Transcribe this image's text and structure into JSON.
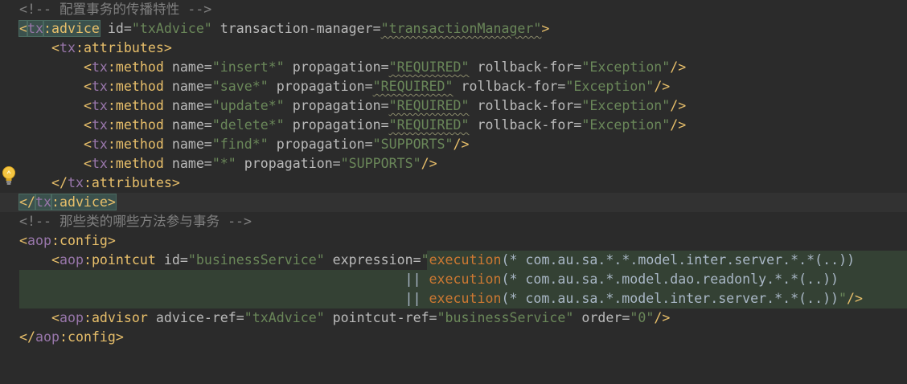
{
  "editor": {
    "language": "xml",
    "lines": [
      {
        "tokens": [
          {
            "t": "<!-- 配置事务的传播特性 -->",
            "c": "cmt"
          }
        ]
      },
      {
        "tokens": [
          {
            "t": "<",
            "c": "tag match"
          },
          {
            "t": "tx",
            "c": "ns match"
          },
          {
            "t": ":advice",
            "c": "tag match"
          },
          {
            "t": " id=",
            "c": "attr"
          },
          {
            "t": "\"txAdvice\"",
            "c": "val"
          },
          {
            "t": " transaction-manager=",
            "c": "attr"
          },
          {
            "t": "\"transactionManager\"",
            "c": "val sq"
          },
          {
            "t": ">",
            "c": "tag"
          }
        ]
      },
      {
        "indent": "    ",
        "tokens": [
          {
            "t": "<",
            "c": "tag"
          },
          {
            "t": "tx",
            "c": "ns"
          },
          {
            "t": ":attributes>",
            "c": "tag"
          }
        ]
      },
      {
        "indent": "        ",
        "tokens": [
          {
            "t": "<",
            "c": "tag"
          },
          {
            "t": "tx",
            "c": "ns"
          },
          {
            "t": ":method",
            "c": "tag"
          },
          {
            "t": " name=",
            "c": "attr"
          },
          {
            "t": "\"insert*\"",
            "c": "val"
          },
          {
            "t": " propagation=",
            "c": "attr"
          },
          {
            "t": "\"REQUIRED\"",
            "c": "val sq"
          },
          {
            "t": " rollback-for=",
            "c": "attr"
          },
          {
            "t": "\"Exception\"",
            "c": "val"
          },
          {
            "t": "/>",
            "c": "tag"
          }
        ]
      },
      {
        "indent": "        ",
        "tokens": [
          {
            "t": "<",
            "c": "tag"
          },
          {
            "t": "tx",
            "c": "ns"
          },
          {
            "t": ":method",
            "c": "tag"
          },
          {
            "t": " name=",
            "c": "attr"
          },
          {
            "t": "\"save*\"",
            "c": "val"
          },
          {
            "t": " propagation=",
            "c": "attr"
          },
          {
            "t": "\"REQUIRED\"",
            "c": "val sq"
          },
          {
            "t": " rollback-for=",
            "c": "attr"
          },
          {
            "t": "\"Exception\"",
            "c": "val"
          },
          {
            "t": "/>",
            "c": "tag"
          }
        ]
      },
      {
        "indent": "        ",
        "tokens": [
          {
            "t": "<",
            "c": "tag"
          },
          {
            "t": "tx",
            "c": "ns"
          },
          {
            "t": ":method",
            "c": "tag"
          },
          {
            "t": " name=",
            "c": "attr"
          },
          {
            "t": "\"update*\"",
            "c": "val"
          },
          {
            "t": " propagation=",
            "c": "attr"
          },
          {
            "t": "\"REQUIRED\"",
            "c": "val sq"
          },
          {
            "t": " rollback-for=",
            "c": "attr"
          },
          {
            "t": "\"Exception\"",
            "c": "val"
          },
          {
            "t": "/>",
            "c": "tag"
          }
        ]
      },
      {
        "indent": "        ",
        "tokens": [
          {
            "t": "<",
            "c": "tag"
          },
          {
            "t": "tx",
            "c": "ns"
          },
          {
            "t": ":method",
            "c": "tag"
          },
          {
            "t": " name=",
            "c": "attr"
          },
          {
            "t": "\"delete*\"",
            "c": "val"
          },
          {
            "t": " propagation=",
            "c": "attr"
          },
          {
            "t": "\"REQUIRED\"",
            "c": "val sq"
          },
          {
            "t": " rollback-for=",
            "c": "attr"
          },
          {
            "t": "\"Exception\"",
            "c": "val"
          },
          {
            "t": "/>",
            "c": "tag"
          }
        ]
      },
      {
        "indent": "        ",
        "tokens": [
          {
            "t": "<",
            "c": "tag"
          },
          {
            "t": "tx",
            "c": "ns"
          },
          {
            "t": ":method",
            "c": "tag"
          },
          {
            "t": " name=",
            "c": "attr"
          },
          {
            "t": "\"find*\"",
            "c": "val"
          },
          {
            "t": " propagation=",
            "c": "attr"
          },
          {
            "t": "\"SUPPORTS\"",
            "c": "val"
          },
          {
            "t": "/>",
            "c": "tag"
          }
        ]
      },
      {
        "indent": "        ",
        "tokens": [
          {
            "t": "<",
            "c": "tag"
          },
          {
            "t": "tx",
            "c": "ns"
          },
          {
            "t": ":method",
            "c": "tag"
          },
          {
            "t": " name=",
            "c": "attr"
          },
          {
            "t": "\"*\"",
            "c": "val"
          },
          {
            "t": " propagation=",
            "c": "attr"
          },
          {
            "t": "\"SUPPORTS\"",
            "c": "val"
          },
          {
            "t": "/>",
            "c": "tag"
          }
        ]
      },
      {
        "indent": "    ",
        "tokens": [
          {
            "t": "</",
            "c": "tag"
          },
          {
            "t": "tx",
            "c": "ns"
          },
          {
            "t": ":attributes>",
            "c": "tag"
          }
        ]
      },
      {
        "current": true,
        "tokens": [
          {
            "t": "</",
            "c": "tag match"
          },
          {
            "t": "tx",
            "c": "ns match"
          },
          {
            "t": ":advice>",
            "c": "tag match"
          }
        ]
      },
      {
        "tokens": [
          {
            "t": "<!-- 那些类的哪些方法参与事务 -->",
            "c": "cmt"
          }
        ]
      },
      {
        "tokens": [
          {
            "t": "<",
            "c": "tag"
          },
          {
            "t": "aop",
            "c": "ns"
          },
          {
            "t": ":config>",
            "c": "tag"
          }
        ]
      },
      {
        "indent": "    ",
        "tokens": [
          {
            "t": "<",
            "c": "tag"
          },
          {
            "t": "aop",
            "c": "ns"
          },
          {
            "t": ":pointcut",
            "c": "tag"
          },
          {
            "t": " id=",
            "c": "attr"
          },
          {
            "t": "\"businessService\"",
            "c": "val"
          },
          {
            "t": " expression=",
            "c": "attr"
          },
          {
            "t": "\"",
            "c": "val"
          },
          {
            "t": "execution",
            "c": "kw"
          },
          {
            "t": "(* com.au.sa.*.*.model.inter.server.*.*(..))",
            "c": "plain"
          }
        ]
      },
      {
        "indent": "                                                ",
        "tokens": [
          {
            "t": "||",
            "c": "plain"
          },
          {
            "t": " ",
            "c": "plain"
          },
          {
            "t": "execution",
            "c": "kw"
          },
          {
            "t": "(* com.au.sa.*.model.dao.readonly.*.*(..))",
            "c": "plain"
          }
        ]
      },
      {
        "indent": "                                                ",
        "tokens": [
          {
            "t": "||",
            "c": "plain"
          },
          {
            "t": " ",
            "c": "plain"
          },
          {
            "t": "execution",
            "c": "kw"
          },
          {
            "t": "(* com.au.sa.*.model.inter.server.*.*(..))",
            "c": "plain"
          },
          {
            "t": "\"",
            "c": "val"
          },
          {
            "t": "/>",
            "c": "tag"
          }
        ]
      },
      {
        "indent": "    ",
        "tokens": [
          {
            "t": "<",
            "c": "tag"
          },
          {
            "t": "aop",
            "c": "ns"
          },
          {
            "t": ":advisor",
            "c": "tag"
          },
          {
            "t": " advice-ref=",
            "c": "attr"
          },
          {
            "t": "\"txAdvice\"",
            "c": "val"
          },
          {
            "t": " pointcut-ref=",
            "c": "attr"
          },
          {
            "t": "\"businessService\"",
            "c": "val"
          },
          {
            "t": " order=",
            "c": "attr"
          },
          {
            "t": "\"0\"",
            "c": "val"
          },
          {
            "t": "/>",
            "c": "tag"
          }
        ]
      },
      {
        "tokens": [
          {
            "t": "</",
            "c": "tag"
          },
          {
            "t": "aop",
            "c": "ns"
          },
          {
            "t": ":config>",
            "c": "tag"
          }
        ]
      }
    ]
  },
  "gutter": {
    "intention_icon": "lightbulb-icon"
  },
  "colors": {
    "background": "#2b2b2b",
    "comment": "#808080",
    "tag": "#e8bf6a",
    "namespace": "#9876aa",
    "attribute": "#bababa",
    "value": "#6a8759",
    "keyword": "#cc7832",
    "injected_highlight": "#344134"
  }
}
